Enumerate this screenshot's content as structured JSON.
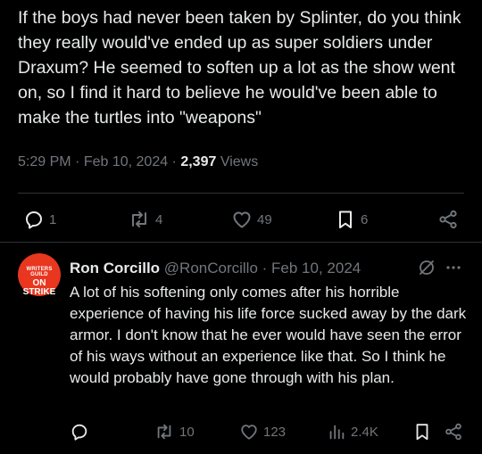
{
  "post": {
    "text": "If the boys had never been taken by Splinter, do you think they really would've ended up as super soldiers under Draxum? He seemed to soften up a lot as the show went on, so I find it hard to believe he would've been able to make the turtles into \"weapons\"",
    "time": "5:29 PM",
    "sep1": " · ",
    "date": "Feb 10, 2024",
    "sep2": " · ",
    "views_count": "2,397",
    "views_label": " Views",
    "replies": "1",
    "reposts": "4",
    "likes": "49",
    "bookmarks": "6"
  },
  "reply": {
    "avatar_line1": "WRITERS GUILD",
    "avatar_line2": "ON STRIKE",
    "name": "Ron Corcillo",
    "handle": "@RonCorcillo",
    "sep": " · ",
    "date": "Feb 10, 2024",
    "text": "A lot of his softening only comes after his horrible experience of having his life force sucked away by the dark armor. I don't know that he ever would have seen the error of his ways without an experience like that. So I think he would probably have gone through with his plan.",
    "reposts": "10",
    "likes": "123",
    "views": "2.4K"
  },
  "colors": {
    "background": "#000000",
    "text": "#e7e9ea",
    "muted": "#71767b",
    "divider": "#2f3336",
    "avatar": "#e8361f"
  }
}
